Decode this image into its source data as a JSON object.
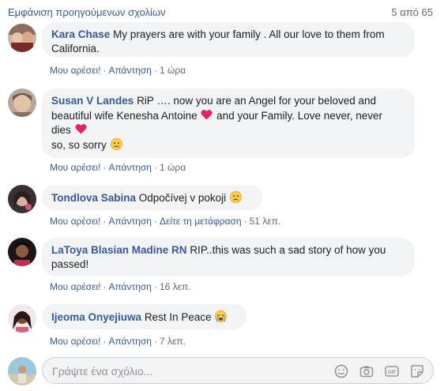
{
  "header": {
    "prev_comments": "Εμφάνιση προηγούμενων σχολίων",
    "count": "5 από 65"
  },
  "actions": {
    "like": "Μου αρέσει!",
    "reply": "Απάντηση",
    "translate": "Δείτε τη μετάφραση",
    "separator": "·"
  },
  "comments": [
    {
      "author": "Kara Chase",
      "text_1": "My prayers are with your family . All our love to them from",
      "text_2": "California.",
      "time": "1 ώρα"
    },
    {
      "author": "Susan V Landes",
      "text_1": "RiP …. now you are an Angel for your beloved and",
      "text_2a": "beautiful wife Kenesha Antoine",
      "text_2b": "and your Family. Love never, never",
      "text_3": "dies",
      "text_4": "so, so sorry",
      "time": "1 ώρα"
    },
    {
      "author": "Tondlova Sabina",
      "text_1": "Odpočívej v pokoji",
      "time": "51 λεπ."
    },
    {
      "author": "LaToya Blasian Madine RN",
      "text_1": "RIP..this was such a sad story of how you",
      "text_2": "passed!",
      "time": "16 λεπ."
    },
    {
      "author": "Ijeoma Onyejiuwa",
      "text_1": "Rest In Peace",
      "time": "7 λεπ."
    }
  ],
  "composer": {
    "placeholder": "Γράψτε ένα σχόλιο..."
  },
  "colors": {
    "link": "#385898",
    "bubble": "#f2f3f5",
    "meta": "#606770",
    "heart": "#e0245e"
  }
}
